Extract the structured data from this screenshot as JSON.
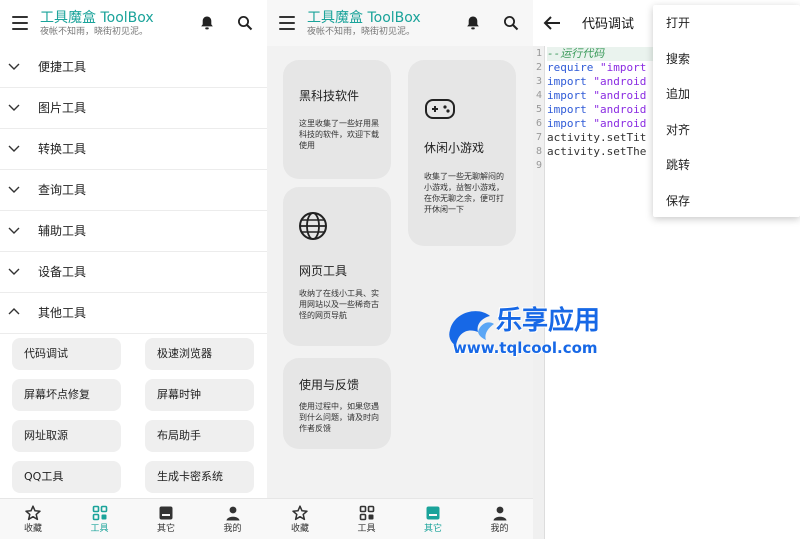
{
  "app": {
    "title": "工具魔盒 ToolBox",
    "subtitle": "夜帐不知雨，晓街初见泥。",
    "accent": "#1aa39a"
  },
  "tools": {
    "categories": [
      {
        "label": "便捷工具",
        "expanded": false
      },
      {
        "label": "图片工具",
        "expanded": false
      },
      {
        "label": "转换工具",
        "expanded": false
      },
      {
        "label": "查询工具",
        "expanded": false
      },
      {
        "label": "辅助工具",
        "expanded": false
      },
      {
        "label": "设备工具",
        "expanded": false
      },
      {
        "label": "其他工具",
        "expanded": true
      }
    ],
    "other_items": [
      "代码调试",
      "极速浏览器",
      "屏幕坏点修复",
      "屏幕时钟",
      "网址取源",
      "布局助手",
      "QQ工具",
      "生成卡密系统"
    ]
  },
  "nav": {
    "items": [
      {
        "label": "收藏",
        "icon": "star-icon"
      },
      {
        "label": "工具",
        "icon": "grid-icon"
      },
      {
        "label": "其它",
        "icon": "box-icon"
      },
      {
        "label": "我的",
        "icon": "person-icon"
      }
    ],
    "panel1_active": "工具",
    "panel2_active": "其它"
  },
  "other": {
    "cards": [
      {
        "title": "黑科技软件",
        "desc": "这里收集了一些好用黑科技的软件，欢迎下载使用",
        "icon": ""
      },
      {
        "title": "休闲小游戏",
        "desc": "收集了一些无聊解闷的小游戏，益智小游戏，在你无聊之余，便可打开休闲一下",
        "icon": "gamepad-icon"
      },
      {
        "title": "网页工具",
        "desc": "收纳了在线小工具、实用网站以及一些稀奇古怪的网页导航",
        "icon": "globe-icon"
      },
      {
        "title": "使用与反馈",
        "desc": "使用过程中，如果您遇到什么问题，请及时向作者反馈",
        "icon": ""
      }
    ]
  },
  "watermark": {
    "text": "乐享应用",
    "url": "www.tqlcool.com",
    "color": "#1768e6"
  },
  "editor": {
    "title": "代码调试",
    "lines": [
      {
        "n": "1",
        "parts": [
          {
            "t": "--运行代码",
            "c": "c-comment"
          }
        ]
      },
      {
        "n": "2",
        "parts": [
          {
            "t": "require ",
            "c": "c-kw"
          },
          {
            "t": "\"import",
            "c": "c-str"
          }
        ]
      },
      {
        "n": "3",
        "parts": [
          {
            "t": "import ",
            "c": "c-kw"
          },
          {
            "t": "\"android",
            "c": "c-str"
          }
        ]
      },
      {
        "n": "4",
        "parts": [
          {
            "t": "import ",
            "c": "c-kw"
          },
          {
            "t": "\"android",
            "c": "c-str"
          }
        ]
      },
      {
        "n": "5",
        "parts": [
          {
            "t": "import ",
            "c": "c-kw"
          },
          {
            "t": "\"android",
            "c": "c-str"
          }
        ]
      },
      {
        "n": "6",
        "parts": [
          {
            "t": "import ",
            "c": "c-kw"
          },
          {
            "t": "\"android",
            "c": "c-str"
          }
        ]
      },
      {
        "n": "7",
        "parts": [
          {
            "t": "activity.setTit",
            "c": "c-plain"
          }
        ]
      },
      {
        "n": "8",
        "parts": [
          {
            "t": "activity.setThe",
            "c": "c-plain"
          }
        ]
      },
      {
        "n": "9",
        "parts": []
      }
    ],
    "menu": [
      "打开",
      "搜索",
      "追加",
      "对齐",
      "跳转",
      "保存"
    ]
  }
}
